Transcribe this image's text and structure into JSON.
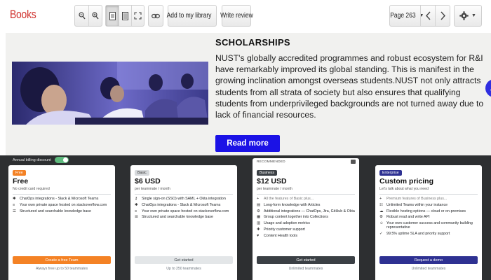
{
  "toolbar": {
    "brand": "Books",
    "add_to_library": "Add to my library",
    "write_review": "Write review",
    "page_label": "Page 263",
    "icons": [
      "zoom-out-icon",
      "zoom-in-icon",
      "single-page-icon",
      "text-view-icon",
      "fullscreen-icon",
      "link-icon",
      "chevron-left-icon",
      "chevron-right-icon",
      "gear-icon"
    ]
  },
  "scholarship": {
    "title": "SCHOLARSHIPS",
    "body": "NUST's globally accredited programmes and robust ecosystem for R&I have remarkably improved its global standing. This is manifest in the growing inclination amongst overseas students.NUST not only attracts students from all strata of society but also ensures that qualifying students from underprivileged backgrounds are not turned away due to lack of financial resources.",
    "button": "Read more",
    "side_tab": "←"
  },
  "pricing": {
    "billing_label": "Annual billing discount",
    "billing_on": true,
    "colors": {
      "orange": "#f48225",
      "navy": "#2e3192",
      "dark": "#3b4045",
      "toggle": "#5eba7d"
    },
    "plans": [
      {
        "badge": "Free",
        "price": "Free",
        "subprice": "No credit card required",
        "features": [
          {
            "icon": "slack-icon",
            "text": "ChatOps integrations - Slack & Microsoft Teams"
          },
          {
            "icon": "stack-icon",
            "text": "Your own private space hosted on stackoverflow.com"
          },
          {
            "icon": "list-icon",
            "text": "Structured and searchable knowledge base"
          }
        ],
        "cta": "Create a free Team",
        "note": "Always free up to 50 teammates"
      },
      {
        "badge": "Basic",
        "price": "$6 USD",
        "subprice": "per teammate / month",
        "features": [
          {
            "icon": "key-icon",
            "text": "Single sign-on (SSO) with SAML + Okta integration"
          },
          {
            "icon": "slack-icon",
            "text": "ChatOps integrations - Slack & Microsoft Teams"
          },
          {
            "icon": "stack-icon",
            "text": "Your own private space hosted on stackoverflow.com"
          },
          {
            "icon": "list-icon",
            "text": "Structured and searchable knowledge base"
          }
        ],
        "cta": "Get started",
        "note": "Up to 250 teammates"
      },
      {
        "recommended": "RECOMMENDED",
        "badge": "Business",
        "price": "$12 USD",
        "subprice": "per teammate / month",
        "features": [
          {
            "icon": "plus-icon",
            "text": "All the features of Basic plus...",
            "muted": true
          },
          {
            "icon": "article-icon",
            "text": "Long-form knowledge with Articles"
          },
          {
            "icon": "integration-icon",
            "text": "Additional integrations — ChatOps, Jira, GitHub & Okta"
          },
          {
            "icon": "collection-icon",
            "text": "Group content together into Collections"
          },
          {
            "icon": "metrics-icon",
            "text": "Usage and adoption metrics"
          },
          {
            "icon": "support-icon",
            "text": "Priority customer support"
          },
          {
            "icon": "health-icon",
            "text": "Content Health tools"
          }
        ],
        "cta": "Get started",
        "note": "Unlimited teammates"
      },
      {
        "badge": "Enterprise",
        "price": "Custom pricing",
        "subprice": "Let's talk about what you need",
        "features": [
          {
            "icon": "plus-icon",
            "text": "Premium features of Business plus...",
            "muted": true
          },
          {
            "icon": "teams-icon",
            "text": "Unlimited Teams within your instance"
          },
          {
            "icon": "hosting-icon",
            "text": "Flexible hosting options — cloud or on-premises"
          },
          {
            "icon": "api-icon",
            "text": "Robust read and write API"
          },
          {
            "icon": "success-icon",
            "text": "Your own customer success and community building representative"
          },
          {
            "icon": "sla-icon",
            "text": "99.5% uptime SLA and priority support"
          }
        ],
        "cta": "Request a demo",
        "note": "Unlimited teammates"
      }
    ]
  }
}
